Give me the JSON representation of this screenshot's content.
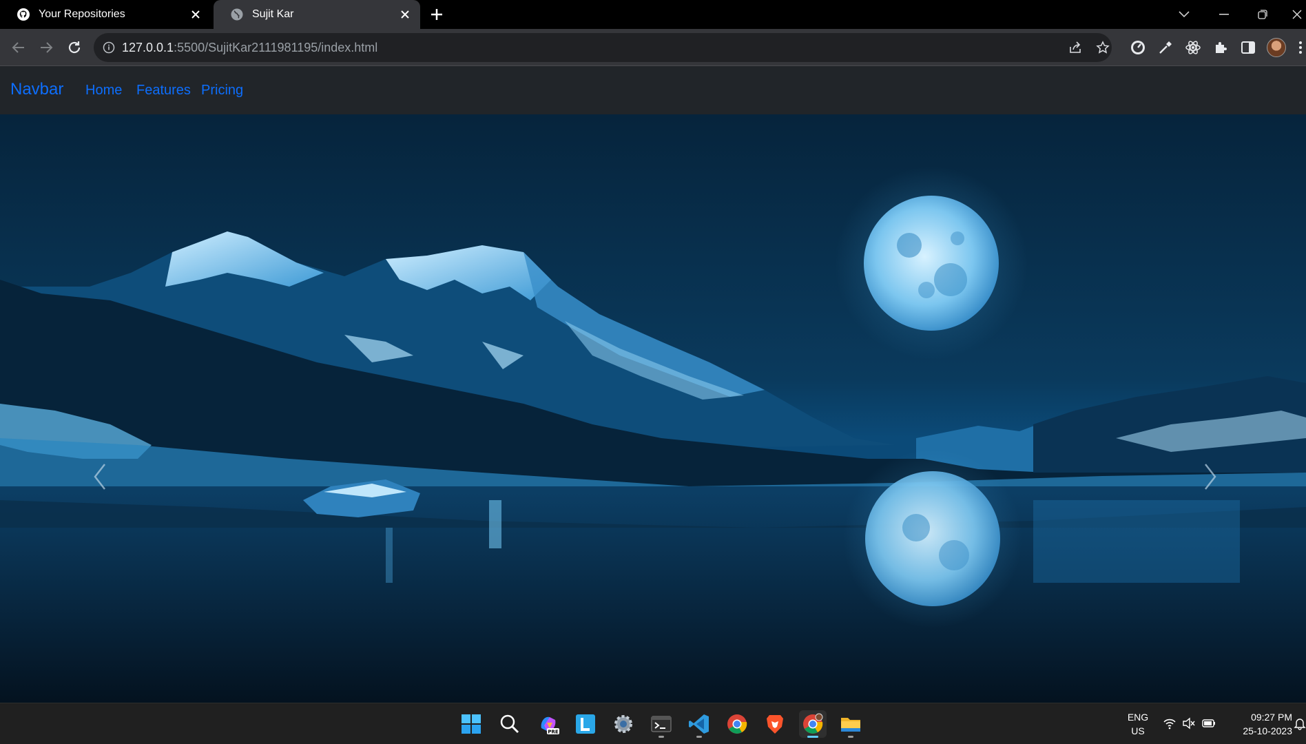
{
  "browser": {
    "tabs": [
      {
        "title": "Your Repositories",
        "favicon": "github-icon",
        "active": false
      },
      {
        "title": "Sujit Kar",
        "favicon": "globe-icon",
        "active": true
      }
    ],
    "address": {
      "host": "127.0.0.1",
      "rest": ":5500/SujitKar2111981195/index.html"
    }
  },
  "page": {
    "navbar": {
      "brand": "Navbar",
      "links": [
        "Home",
        "Features",
        "Pricing"
      ],
      "link_color": "#0d6efd",
      "background": "#212529"
    },
    "carousel": {
      "image": "night-lake-mountain-full-moon",
      "prev_icon": "chevron-left-icon",
      "next_icon": "chevron-right-icon"
    }
  },
  "taskbar": {
    "apps": [
      "windows-start",
      "search",
      "copilot-pre",
      "l-app",
      "settings",
      "terminal",
      "vscode",
      "chrome",
      "brave",
      "chrome-profile",
      "file-explorer"
    ],
    "language": {
      "line1": "ENG",
      "line2": "US"
    },
    "time": "09:27 PM",
    "date": "25-10-2023"
  }
}
